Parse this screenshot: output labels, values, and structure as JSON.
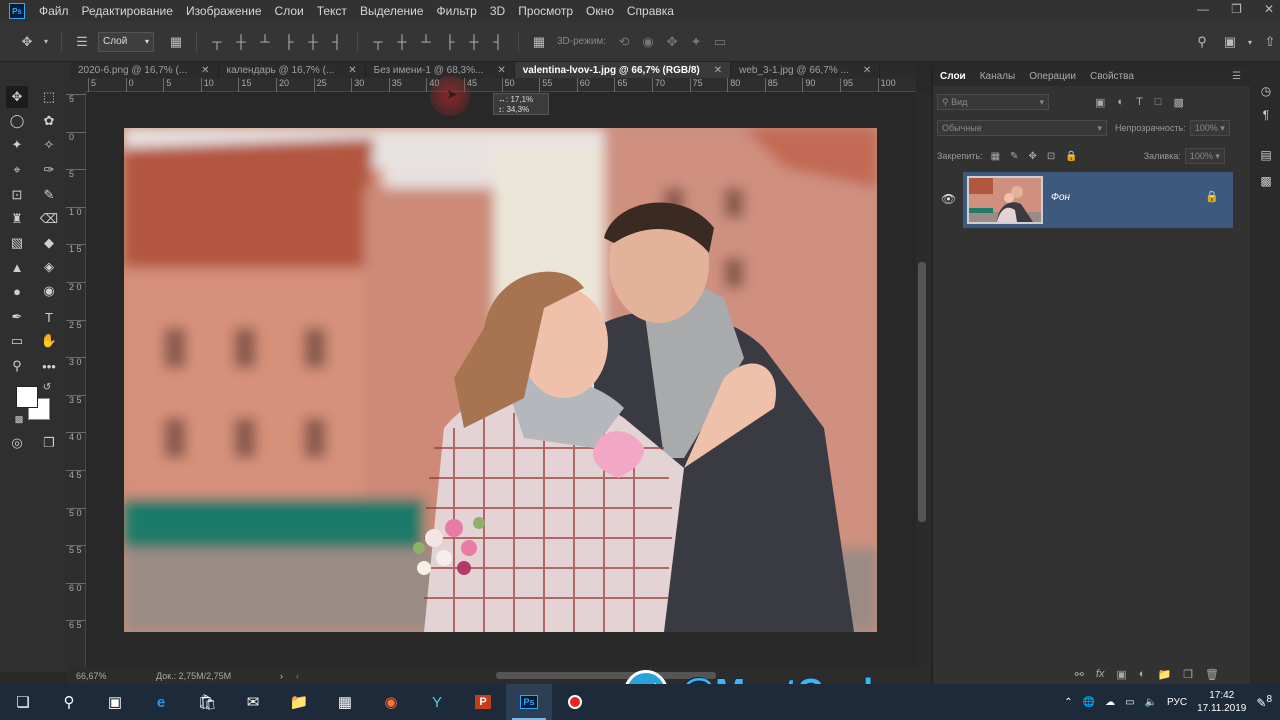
{
  "app": {
    "logo": "Ps"
  },
  "menu": [
    "Файл",
    "Редактирование",
    "Изображение",
    "Слои",
    "Текст",
    "Выделение",
    "Фильтр",
    "3D",
    "Просмотр",
    "Окно",
    "Справка"
  ],
  "window_controls": [
    "minimize-icon",
    "restore-icon",
    "close-icon"
  ],
  "options_bar": {
    "auto_select_value": "Слой",
    "mode_3d": "3D-режим:"
  },
  "tabs": [
    {
      "label": "2020-6.png @ 16,7% (...",
      "active": false
    },
    {
      "label": "календарь @ 16,7% (...",
      "active": false
    },
    {
      "label": "Без имени-1 @ 68,3%...",
      "active": false
    },
    {
      "label": "valentina-lvov-1.jpg @ 66,7% (RGB/8)",
      "active": true
    },
    {
      "label": "web_3-1.jpg @ 66,7% ...",
      "active": false
    }
  ],
  "ruler_top_labels": [
    "5",
    "0",
    "5",
    "10",
    "15",
    "20",
    "25",
    "30",
    "35",
    "40",
    "45",
    "50",
    "55",
    "60",
    "65",
    "70",
    "75",
    "80",
    "85",
    "90",
    "95",
    "100"
  ],
  "ruler_left_labels": [
    "5",
    "0",
    "5",
    "1 0",
    "1 5",
    "2 0",
    "2 5",
    "3 0",
    "3 5",
    "4 0",
    "4 5",
    "5 0",
    "5 5",
    "6 0",
    "6 5"
  ],
  "transform_tooltip": {
    "w": "↔: 17,1%",
    "h": "↕: 34,3%"
  },
  "status": {
    "zoom": "66,67%",
    "doc": "Док.: 2,75M/2,75M"
  },
  "panel": {
    "tabs": [
      "Слои",
      "Каналы",
      "Операции",
      "Свойства"
    ],
    "filter_placeholder": "Вид",
    "blend_mode": "Обычные",
    "opacity_label": "Непрозрачность:",
    "opacity_value": "100%",
    "lock_label": "Закрепить:",
    "fill_label": "Заливка:",
    "fill_value": "100%",
    "layers": [
      {
        "name": "Фон",
        "visible": true,
        "locked": true
      }
    ]
  },
  "taskbar": {
    "lang": "РУС",
    "time": "17:42",
    "date": "17.11.2019",
    "notifications": "8"
  },
  "watermark": {
    "text": "@MeatCash"
  },
  "colors": {
    "accent": "#31a8ff",
    "layer_selected": "#3d5a7e",
    "watermark": "#3fb6f0"
  }
}
